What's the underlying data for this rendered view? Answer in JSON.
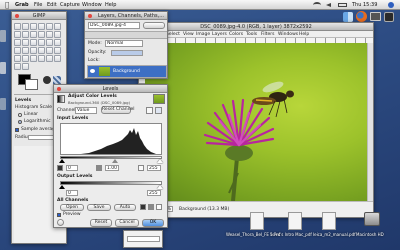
{
  "menubar": {
    "app": "Grab",
    "items": [
      "File",
      "Edit",
      "Capture",
      "Window",
      "Help"
    ],
    "clock": "Thu 15:39"
  },
  "toolbox": {
    "title": "GIMP",
    "tool_options_label": "Levels",
    "histogram_scale_label": "Histogram Scale",
    "linear_label": "Linear",
    "log_label": "Logarithmic",
    "sample_average_label": "Sample average",
    "radius_label": "Radius"
  },
  "layers": {
    "title": "Layers, Channels, Paths,...",
    "image_name": "DSC_0089.jpg-4",
    "mode_label": "Mode:",
    "mode_value": "Normal",
    "opacity_label": "Opacity:",
    "lock_label": "Lock:",
    "layer_name": "Background"
  },
  "image_window": {
    "title": "DSC_0089.jpg-4.0 (RGB, 1 layer) 3872x2592",
    "menu": [
      "File",
      "Edit",
      "Select",
      "View",
      "Image",
      "Layers",
      "Colors",
      "Tools",
      "Filters",
      "Windows",
      "Help"
    ],
    "zoom": "25%",
    "status": "Background (13.3 MB)"
  },
  "levels": {
    "title": "Levels",
    "heading": "Adjust Color Levels",
    "subheading": "Background-360 (DSC_0089.jpg)",
    "channel_label": "Channel:",
    "channel_value": "Value",
    "reset_channel": "Reset Channel",
    "input_levels_label": "Input Levels",
    "input_low": "0",
    "input_gamma": "1.00",
    "input_high": "255",
    "output_levels_label": "Output Levels",
    "output_low": "0",
    "output_high": "255",
    "all_channels_label": "All Channels",
    "open_label": "Open",
    "save_label": "Save",
    "auto_label": "Auto",
    "preview_label": "Preview",
    "reset_label": "Reset",
    "cancel_label": "Cancel",
    "ok_label": "OK"
  },
  "desktop_files": [
    "Weasel_Thora_Bel_FE ss.v4",
    "5 Pro's Intro Mac_pdf",
    "leica_m2_manual.pdf",
    "Macintosh HD"
  ]
}
